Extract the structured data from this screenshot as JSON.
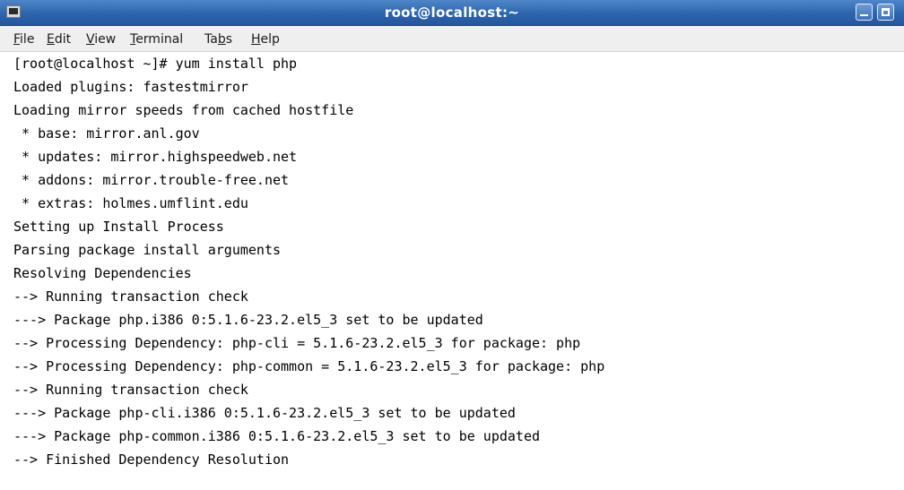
{
  "window": {
    "title": "root@localhost:~",
    "minimize_icon": "minimize-icon",
    "maximize_icon": "maximize-icon",
    "app_icon": "terminal-icon"
  },
  "menubar": {
    "items": [
      {
        "pre": "",
        "ul": "F",
        "post": "ile"
      },
      {
        "pre": "",
        "ul": "E",
        "post": "dit"
      },
      {
        "pre": "",
        "ul": "V",
        "post": "iew"
      },
      {
        "pre": "",
        "ul": "T",
        "post": "erminal"
      },
      {
        "pre": "Ta",
        "ul": "b",
        "post": "s"
      },
      {
        "pre": "",
        "ul": "H",
        "post": "elp"
      }
    ]
  },
  "terminal": {
    "lines": [
      "[root@localhost ~]# yum install php",
      "Loaded plugins: fastestmirror",
      "Loading mirror speeds from cached hostfile",
      " * base: mirror.anl.gov",
      " * updates: mirror.highspeedweb.net",
      " * addons: mirror.trouble-free.net",
      " * extras: holmes.umflint.edu",
      "Setting up Install Process",
      "Parsing package install arguments",
      "Resolving Dependencies",
      "--> Running transaction check",
      "---> Package php.i386 0:5.1.6-23.2.el5_3 set to be updated",
      "--> Processing Dependency: php-cli = 5.1.6-23.2.el5_3 for package: php",
      "--> Processing Dependency: php-common = 5.1.6-23.2.el5_3 for package: php",
      "--> Running transaction check",
      "---> Package php-cli.i386 0:5.1.6-23.2.el5_3 set to be updated",
      "---> Package php-common.i386 0:5.1.6-23.2.el5_3 set to be updated",
      "--> Finished Dependency Resolution"
    ]
  }
}
